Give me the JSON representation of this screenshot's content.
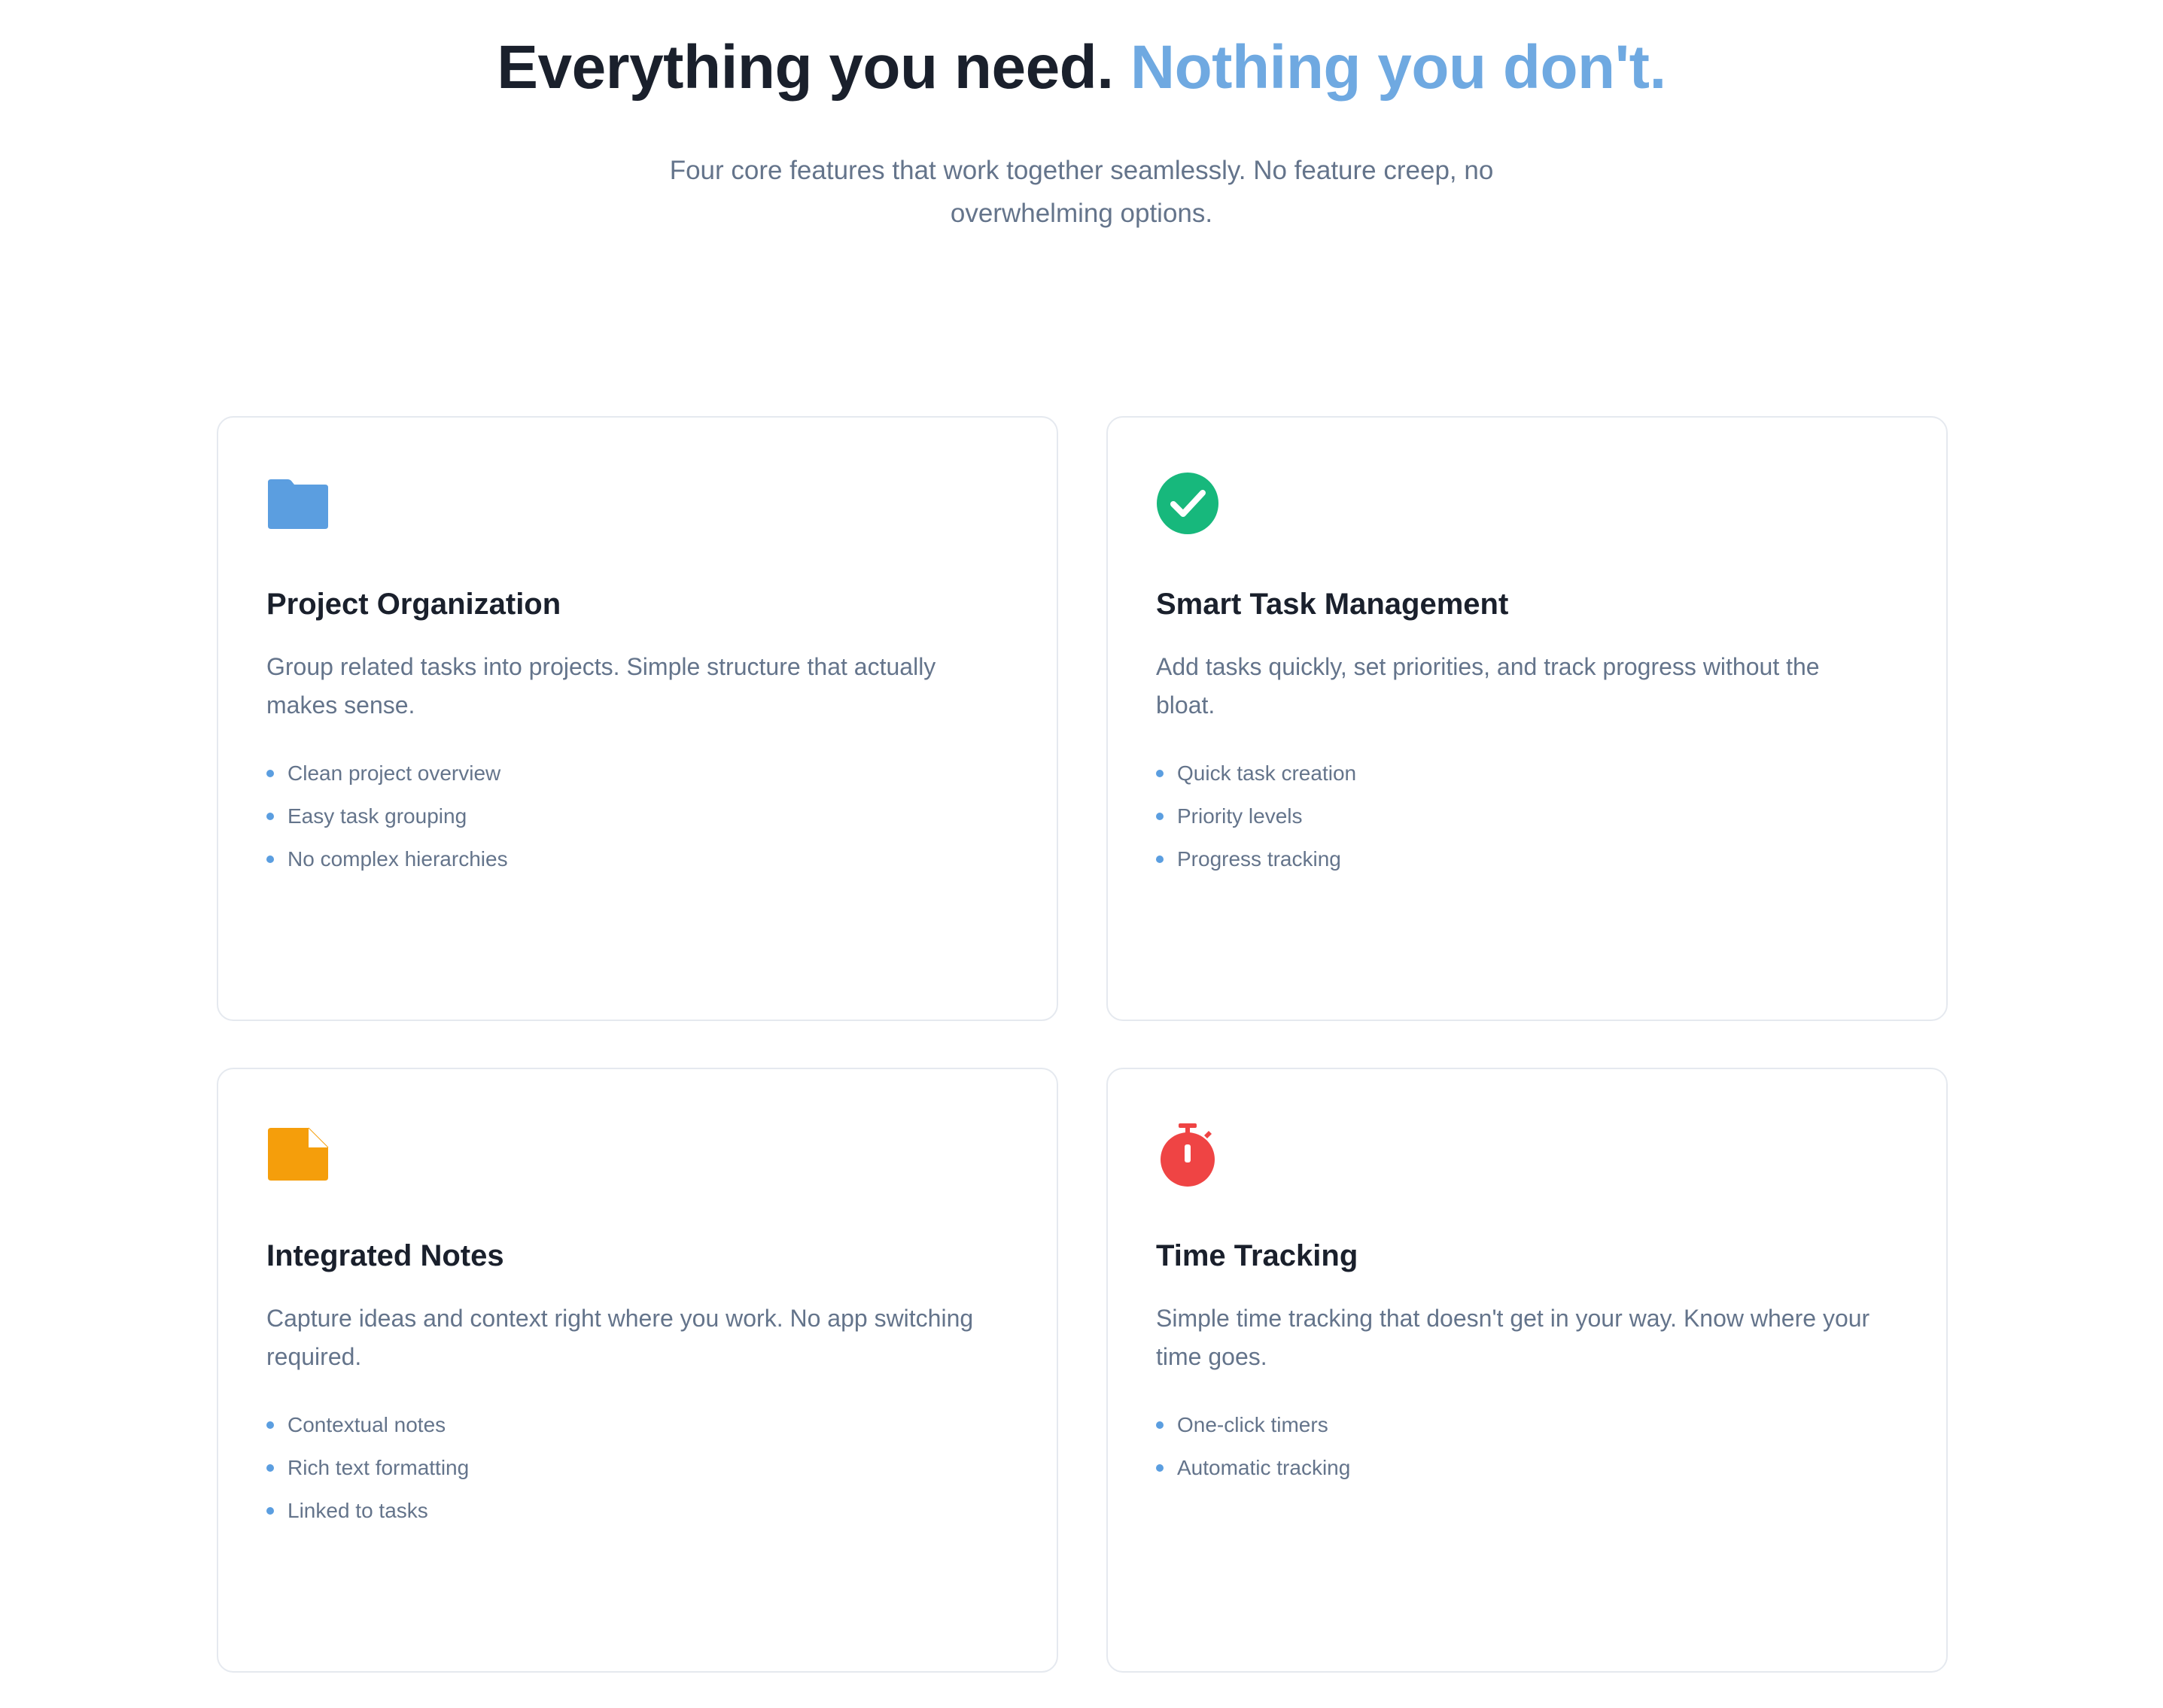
{
  "hero": {
    "title_main": "Everything you need.",
    "title_accent": "Nothing you don't.",
    "subtitle": "Four core features that work together seamlessly. No feature creep, no overwhelming options."
  },
  "colors": {
    "accent": "#6fa9e1",
    "bullet": "#5b9ee0",
    "folder_icon": "#5b9ee0",
    "check_icon": "#17b87c",
    "note_icon": "#f59e0b",
    "stopwatch_icon": "#ef4444"
  },
  "features": [
    {
      "icon": "folder-icon",
      "title": "Project Organization",
      "description": "Group related tasks into projects. Simple structure that actually makes sense.",
      "items": [
        "Clean project overview",
        "Easy task grouping",
        "No complex hierarchies"
      ]
    },
    {
      "icon": "check-circle-icon",
      "title": "Smart Task Management",
      "description": "Add tasks quickly, set priorities, and track progress without the bloat.",
      "items": [
        "Quick task creation",
        "Priority levels",
        "Progress tracking"
      ]
    },
    {
      "icon": "note-icon",
      "title": "Integrated Notes",
      "description": "Capture ideas and context right where you work. No app switching required.",
      "items": [
        "Contextual notes",
        "Rich text formatting",
        "Linked to tasks"
      ]
    },
    {
      "icon": "stopwatch-icon",
      "title": "Time Tracking",
      "description": "Simple time tracking that doesn't get in your way. Know where your time goes.",
      "items": [
        "One-click timers",
        "Automatic tracking"
      ]
    }
  ]
}
